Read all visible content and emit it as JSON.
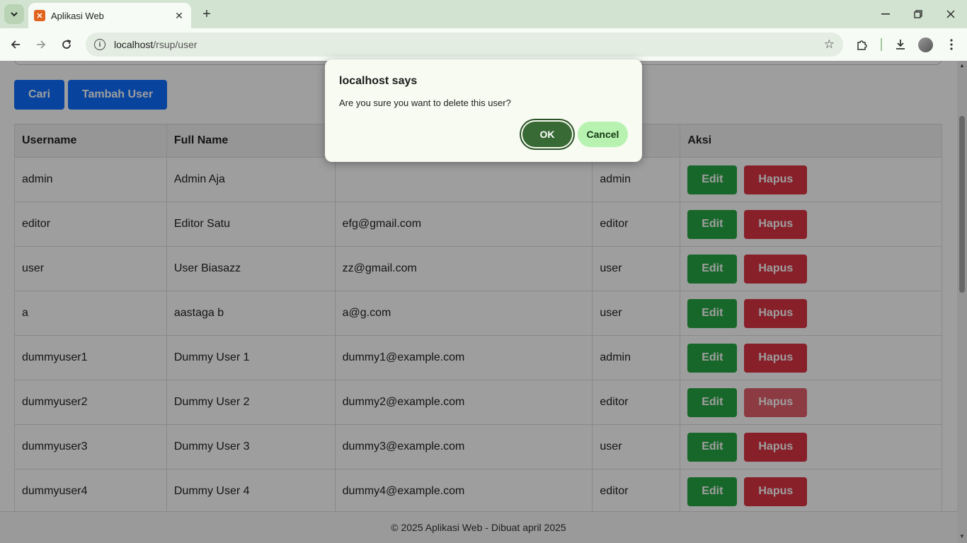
{
  "browser": {
    "tab_title": "Aplikasi Web",
    "url_host": "localhost",
    "url_path": "/rsup/user"
  },
  "page": {
    "buttons": {
      "search": "Cari",
      "add_user": "Tambah User"
    },
    "table": {
      "headers": [
        "Username",
        "Full Name",
        "",
        "",
        "Aksi"
      ],
      "rows": [
        {
          "username": "admin",
          "full_name": "Admin Aja",
          "email": "",
          "role": "admin"
        },
        {
          "username": "editor",
          "full_name": "Editor Satu",
          "email": "efg@gmail.com",
          "role": "editor"
        },
        {
          "username": "user",
          "full_name": "User Biasazz",
          "email": "zz@gmail.com",
          "role": "user"
        },
        {
          "username": "a",
          "full_name": "aastaga b",
          "email": "a@g.com",
          "role": "user"
        },
        {
          "username": "dummyuser1",
          "full_name": "Dummy User 1",
          "email": "dummy1@example.com",
          "role": "admin"
        },
        {
          "username": "dummyuser2",
          "full_name": "Dummy User 2",
          "email": "dummy2@example.com",
          "role": "editor"
        },
        {
          "username": "dummyuser3",
          "full_name": "Dummy User 3",
          "email": "dummy3@example.com",
          "role": "user"
        },
        {
          "username": "dummyuser4",
          "full_name": "Dummy User 4",
          "email": "dummy4@example.com",
          "role": "editor"
        }
      ],
      "edit_label": "Edit",
      "delete_label": "Hapus"
    },
    "footer": "© 2025 Aplikasi Web - Dibuat april 2025"
  },
  "dialog": {
    "title": "localhost says",
    "message": "Are you sure you want to delete this user?",
    "ok_label": "OK",
    "cancel_label": "Cancel"
  },
  "icons": {
    "tab_menu": "chevron-down-icon",
    "favicon": "xampp-icon",
    "back": "arrow-left-icon",
    "forward": "arrow-right-icon",
    "reload": "reload-icon",
    "site_info": "info-icon",
    "bookmark": "star-icon",
    "extensions": "puzzle-icon",
    "downloads": "download-icon",
    "menu": "kebab-menu-icon"
  }
}
